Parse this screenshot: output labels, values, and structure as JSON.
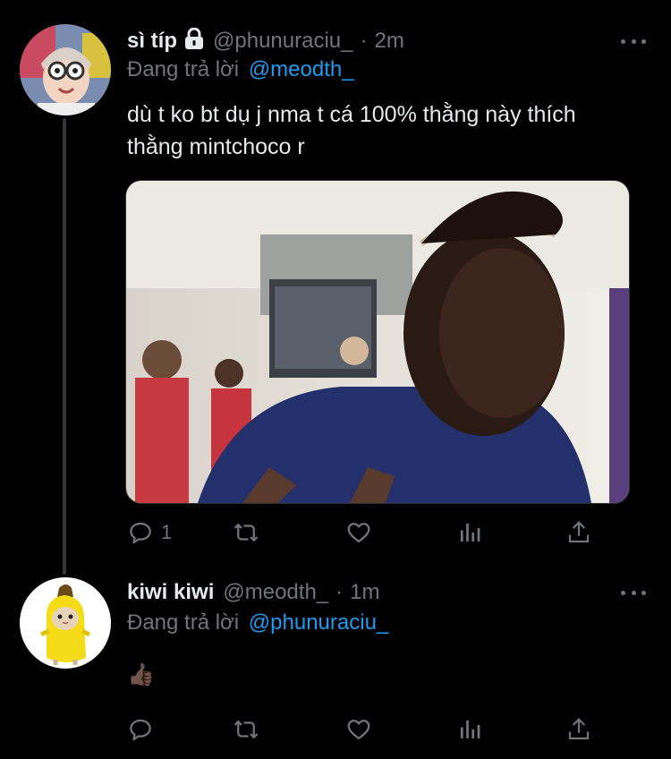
{
  "tweets": [
    {
      "display_name": "sì típ",
      "handle": "@phunuraciu_",
      "separator": "·",
      "time": "2m",
      "reply_prefix": "Đang trả lời",
      "reply_to": "@meodth_",
      "text": "dù t ko bt dụ j nma t cá 100% thằng này thích thằng mintchoco r",
      "reply_count": "1",
      "locked": true
    },
    {
      "display_name": "kiwi kiwi",
      "handle": "@meodth_",
      "separator": "·",
      "time": "1m",
      "reply_prefix": "Đang trả lời",
      "reply_to": "@phunuraciu_",
      "text": "👍🏿",
      "reply_count": ""
    }
  ],
  "icons": {
    "reply": "reply-icon",
    "retweet": "retweet-icon",
    "like": "like-icon",
    "analytics": "analytics-icon",
    "share": "share-icon",
    "more": "more-icon",
    "lock": "lock-icon"
  },
  "colors": {
    "background": "#000000",
    "text": "#e7e9ea",
    "muted": "#71767b",
    "link": "#1d9bf0"
  }
}
